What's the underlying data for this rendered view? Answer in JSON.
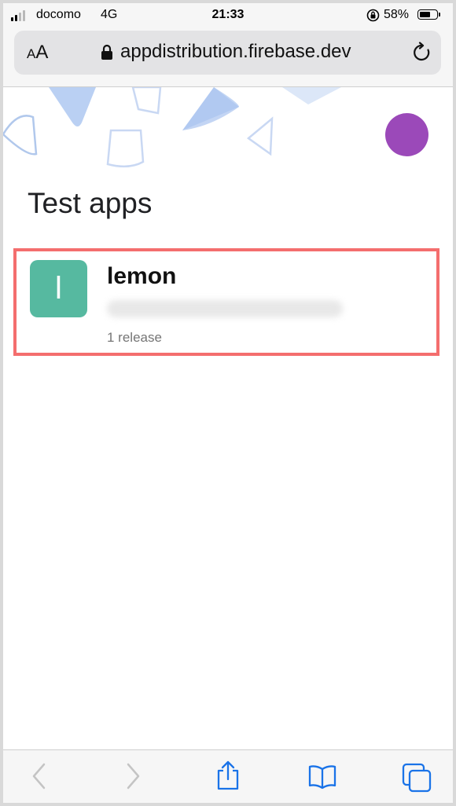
{
  "status_bar": {
    "carrier": "docomo",
    "network": "4G",
    "time": "21:33",
    "battery_percent": "58%",
    "battery_level": 0.58,
    "signal_bars": 2,
    "icons": [
      "signal-icon",
      "rotation-lock-icon",
      "battery-icon"
    ]
  },
  "browser": {
    "text_size_label_small": "A",
    "text_size_label_large": "A",
    "url": "appdistribution.firebase.dev",
    "icons": [
      "lock-icon",
      "reload-icon"
    ]
  },
  "page": {
    "title": "Test apps",
    "avatar_color": "#9b49b9"
  },
  "apps": [
    {
      "icon_letter": "l",
      "icon_color": "#56b9a0",
      "name": "lemon",
      "release_count": "1 release"
    }
  ],
  "highlight_color": "#f46e6e",
  "toolbar": {
    "icons": [
      "back-icon",
      "forward-icon",
      "share-icon",
      "bookmarks-icon",
      "tabs-icon"
    ],
    "accent": "#1a73e8"
  }
}
